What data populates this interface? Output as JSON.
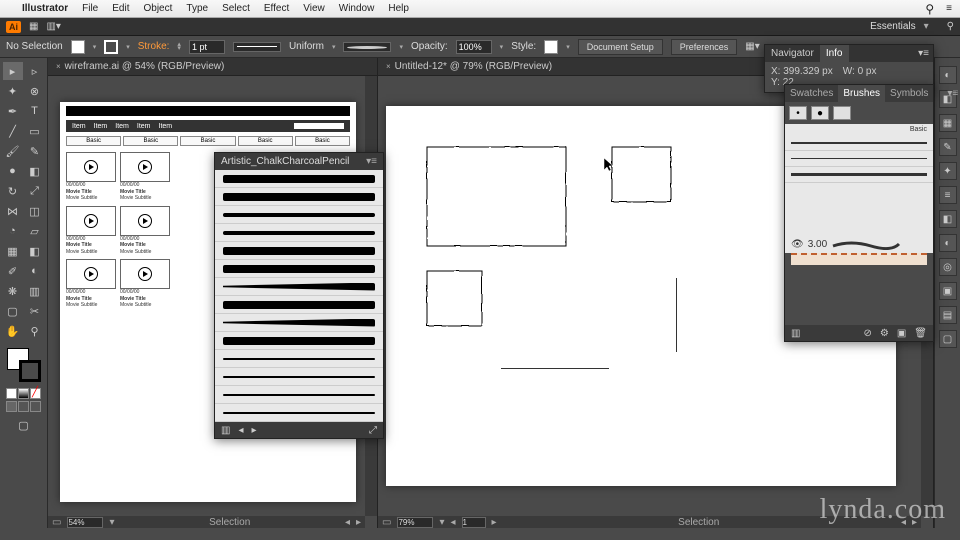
{
  "menubar": {
    "app": "Illustrator",
    "items": [
      "File",
      "Edit",
      "Object",
      "Type",
      "Select",
      "Effect",
      "View",
      "Window",
      "Help"
    ]
  },
  "appbar": {
    "workspace": "Essentials"
  },
  "control": {
    "selection": "No Selection",
    "stroke_label": "Stroke:",
    "stroke_weight": "1 pt",
    "profile": "Uniform",
    "opacity_label": "Opacity:",
    "opacity": "100%",
    "style_label": "Style:",
    "doc_setup": "Document Setup",
    "prefs": "Preferences"
  },
  "docs": {
    "left": {
      "title": "wireframe.ai @ 54% (RGB/Preview)",
      "zoom": "54%",
      "status": "Selection",
      "nav_items": [
        "Item",
        "Item",
        "Item",
        "Item",
        "Item"
      ],
      "tab_labels": [
        "Basic",
        "Basic",
        "Basic",
        "Basic",
        "Basic"
      ],
      "card": {
        "date": "00/00/00",
        "title": "Movie Title",
        "subtitle": "Movie Subtitle"
      }
    },
    "right": {
      "title": "Untitled-12* @ 79% (RGB/Preview)",
      "zoom": "79%",
      "status": "Selection",
      "page": "1"
    }
  },
  "brush_lib": {
    "title": "Artistic_ChalkCharcoalPencil"
  },
  "info": {
    "tab_nav": "Navigator",
    "tab_info": "Info",
    "x_label": "X:",
    "x": "399.329 px",
    "y_label": "Y:",
    "y": "22",
    "w_label": "W:",
    "w": "0 px"
  },
  "brushes": {
    "tabs": [
      "Swatches",
      "Brushes",
      "Symbols"
    ],
    "basic_label": "Basic",
    "size": "3.00"
  },
  "watermark": "lynda.com"
}
